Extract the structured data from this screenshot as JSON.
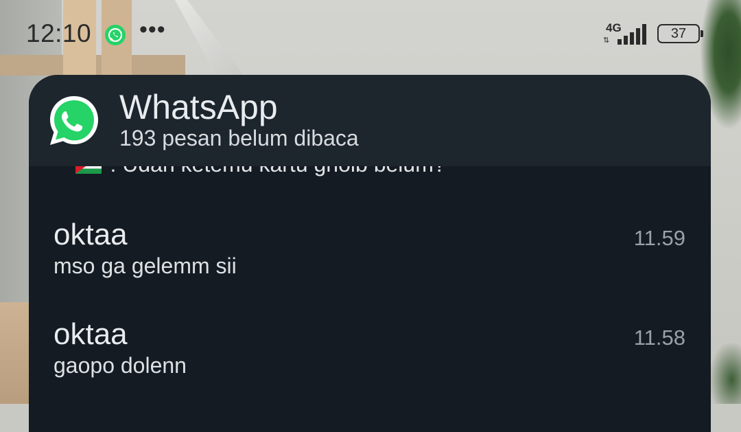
{
  "status_bar": {
    "time": "12:10",
    "notification_icons": [
      "whatsapp-icon",
      "more-dots-icon"
    ],
    "more_indicator": "•••",
    "network_type": "4G",
    "network_arrows": "⇅",
    "battery_level": "37"
  },
  "notification": {
    "app_name": "WhatsApp",
    "unread_summary": "193 pesan belum dibaca",
    "clipped_preview": {
      "prefix": "~",
      "text": ": Udah ketemu kartu ghoib belum?"
    },
    "messages": [
      {
        "sender": "oktaa",
        "time": "11.59",
        "text": "mso ga gelemm sii"
      },
      {
        "sender": "oktaa",
        "time": "11.58",
        "text": "gaopo dolenn"
      }
    ]
  },
  "colors": {
    "card_background": "#151b22",
    "card_header": "#1d252d",
    "whatsapp_green": "#25d366"
  }
}
